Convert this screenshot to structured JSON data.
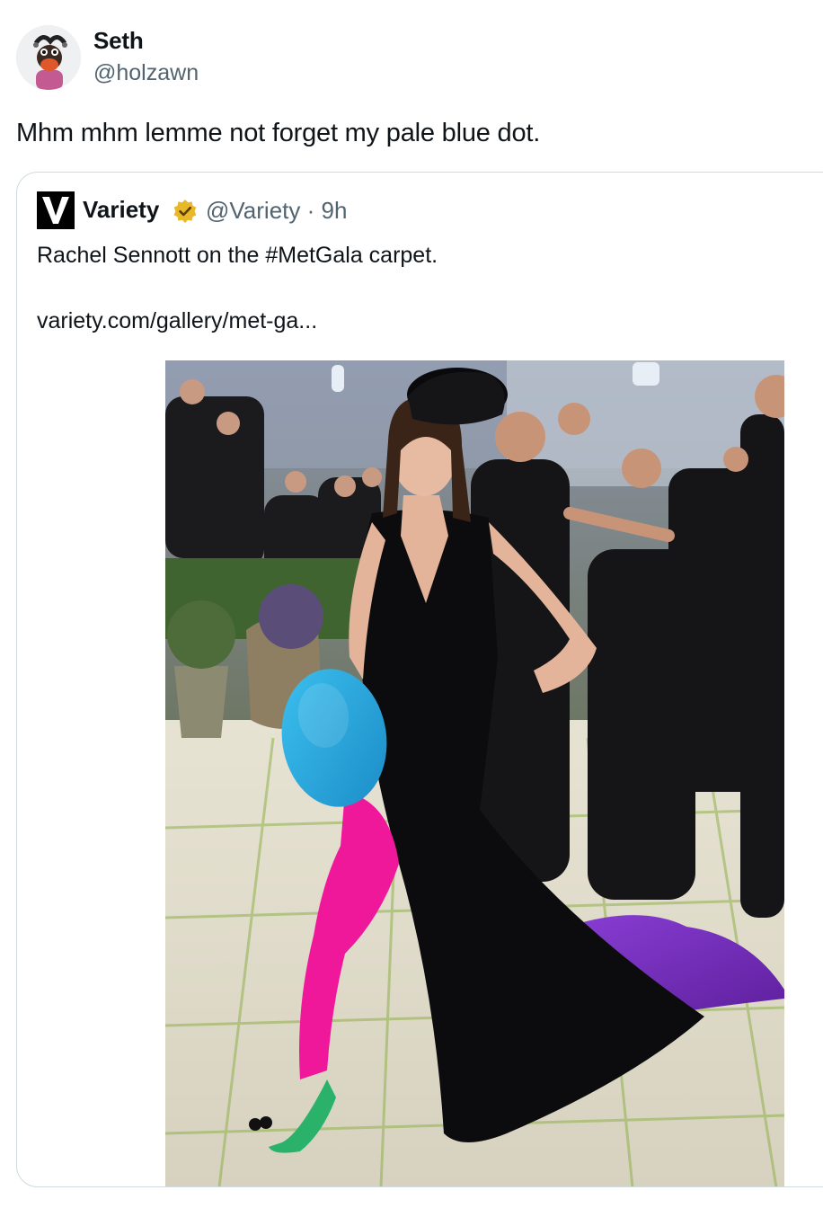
{
  "tweet": {
    "author": {
      "name": "Seth",
      "handle": "@holzawn",
      "avatar_icon": "puppet-avatar-icon"
    },
    "text": "Mhm mhm lemme not forget my pale blue dot."
  },
  "quote": {
    "author": {
      "name": "Variety",
      "handle": "@Variety",
      "separator": "·",
      "time": "9h",
      "logo_icon": "variety-logo-icon",
      "badge_icon": "verified-gold-badge-icon"
    },
    "text": "Rachel Sennott on the #MetGala carpet.",
    "link": "variety.com/gallery/met-ga...",
    "media": {
      "type": "photo",
      "description_icon": "red-carpet-photo",
      "accent_colors": {
        "blue_dot": "#29a8e0",
        "tights": "#f0189a",
        "train": "#7a2fc0",
        "dress": "#0c0c0e"
      }
    }
  }
}
